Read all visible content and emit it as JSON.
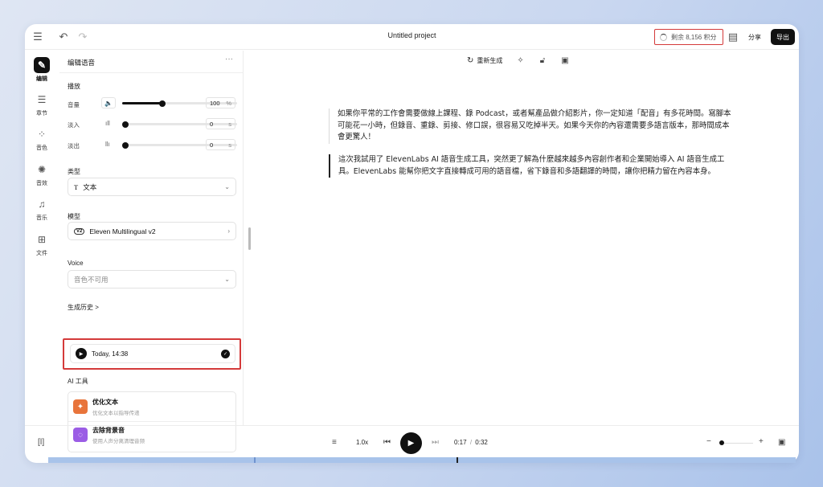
{
  "app": {
    "title": "Untitled project",
    "credits": "剩余 8,156 积分",
    "share": "分享",
    "export": "导出"
  },
  "rail": [
    {
      "label": "编辑",
      "icon": "edit-icon",
      "glyph": "✎"
    },
    {
      "label": "章节",
      "icon": "chapters-icon",
      "glyph": "☰"
    },
    {
      "label": "音色",
      "icon": "voices-icon",
      "glyph": "⁘"
    },
    {
      "label": "音效",
      "icon": "sound-effects-icon",
      "glyph": "✺"
    },
    {
      "label": "音乐",
      "icon": "music-icon",
      "glyph": "♫"
    },
    {
      "label": "文件",
      "icon": "files-icon",
      "glyph": "⊞"
    }
  ],
  "panel": {
    "title": "编辑语音",
    "playback_heading": "播放",
    "volume_label": "音量",
    "volume_value": "100",
    "volume_unit": "%",
    "volume_level": 0.35,
    "fade_in_label": "淡入",
    "fade_in_value": "0",
    "fade_out_label": "淡出",
    "fade_out_value": "0",
    "seconds_unit": "s",
    "type_heading": "类型",
    "type_value": "文本",
    "model_heading": "模型",
    "model_badge": "V2",
    "model_value": "Eleven Multilingual v2",
    "voice_heading": "Voice",
    "voice_value": "音色不可用",
    "history_heading": "生成历史 >",
    "history_item": "Today, 14:38",
    "ai_tools_heading": "AI 工具",
    "tools": [
      {
        "title": "优化文本",
        "subtitle": "优化文本以指导传递",
        "color": "#e8743b"
      },
      {
        "title": "去除背景音",
        "subtitle": "使用人声分离清理音频",
        "color": "#9b5de5"
      }
    ]
  },
  "editor": {
    "regenerate": "重新生成",
    "paragraphs": [
      "如果你平常的工作會需要做線上課程、錄 Podcast，或者幫產品做介紹影片，你一定知道「配音」有多花時間。寫腳本可能花一小時，但錄音、重錄、剪接、修口誤，很容易又吃掉半天。如果今天你的內容還需要多語言版本，那時間成本會更驚人！",
      "這次我試用了 ElevenLabs AI 語音生成工具，突然更了解為什麼越來越多內容創作者和企業開始導入 AI 語音生成工具。ElevenLabs 能幫你把文字直接轉成可用的語音檔，省下錄音和多語翻譯的時間，讓你把精力留在內容本身。"
    ]
  },
  "player": {
    "speed": "1.0x",
    "current_time": "0:17",
    "separator": "/",
    "total_time": "0:32"
  }
}
